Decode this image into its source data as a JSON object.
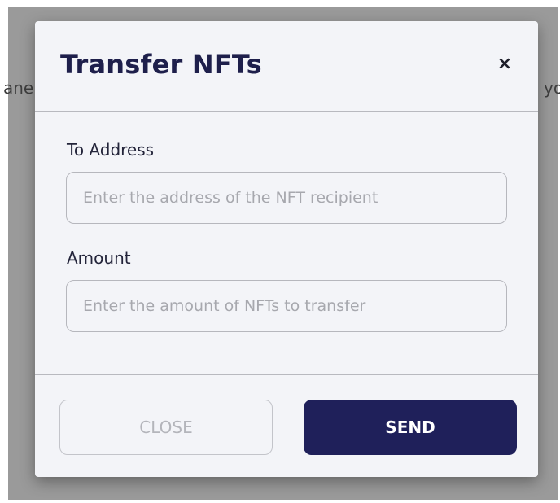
{
  "background": {
    "left_fragment": "ane",
    "right_fragment": "yo"
  },
  "modal": {
    "title": "Transfer NFTs",
    "close_glyph": "×",
    "close_icon": "close-icon"
  },
  "form": {
    "address": {
      "label": "To Address",
      "placeholder": "Enter the address of the NFT recipient",
      "value": ""
    },
    "amount": {
      "label": "Amount",
      "placeholder": "Enter the amount of NFTs to transfer",
      "value": ""
    }
  },
  "footer": {
    "close_label": "CLOSE",
    "send_label": "SEND"
  },
  "colors": {
    "brand_navy": "#1f205a",
    "modal_bg": "#f3f4f8",
    "backdrop": "#9a9a9a"
  }
}
